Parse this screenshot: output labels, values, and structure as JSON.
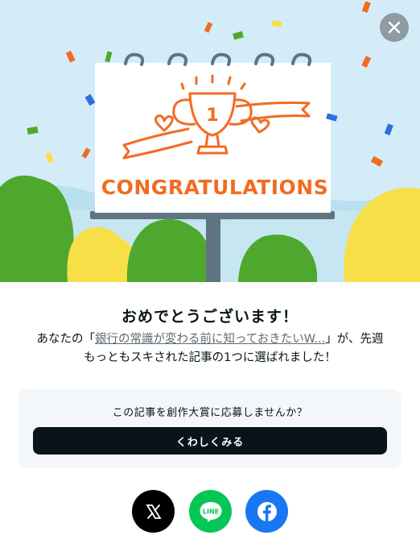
{
  "hero": {
    "banner_text": "CONGRATULATIONS",
    "trophy_number": "1",
    "colors": {
      "sky": "#d3ecf8",
      "accent": "#f26b21",
      "green": "#4ea82e",
      "yellow": "#f7df48"
    }
  },
  "close": {
    "icon": "close-icon"
  },
  "dialog": {
    "title": "おめでとうございます！",
    "desc_prefix": "あなたの「",
    "article_title": "銀行の常識が変わる前に知っておきたいW...",
    "desc_suffix": "」が、先週",
    "desc_line2": "もっともスキされた記事の1つに選ばれました！"
  },
  "contest": {
    "prompt": "この記事を創作大賞に応募しませんか？",
    "button_label": "くわしくみる"
  },
  "share": {
    "x_icon": "x-logo-icon",
    "x_letter": "𝕏",
    "line_icon": "line-logo-icon",
    "line_text": "LINE",
    "facebook_icon": "facebook-logo-icon",
    "facebook_letter": "f"
  }
}
